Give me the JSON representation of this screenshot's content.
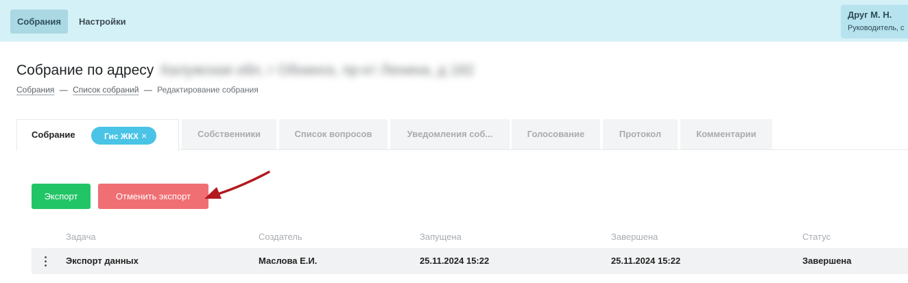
{
  "nav": {
    "items": [
      {
        "label": "Собрания"
      },
      {
        "label": "Настройки"
      }
    ]
  },
  "user": {
    "name": "Друг М. Н.",
    "role": "Руководитель, с"
  },
  "page": {
    "title": "Собрание по адресу",
    "address": "Калужская обл, г Обнинск, пр-кт Ленина, д 182"
  },
  "breadcrumb": {
    "items": [
      "Собрания",
      "Список собраний",
      "Редактирование собрания"
    ],
    "separator": "—"
  },
  "tabs": [
    {
      "label": "Собрание"
    },
    {
      "label": "Собственники"
    },
    {
      "label": "Список вопросов"
    },
    {
      "label": "Уведомления соб..."
    },
    {
      "label": "Голосование"
    },
    {
      "label": "Протокол"
    },
    {
      "label": "Комментарии"
    }
  ],
  "gis_chip": {
    "label": "Гис ЖКХ",
    "close": "×"
  },
  "actions": {
    "export_label": "Экспорт",
    "cancel_export_label": "Отменить экспорт"
  },
  "table": {
    "columns": [
      "Задача",
      "Создатель",
      "Запущена",
      "Завершена",
      "Статус"
    ],
    "rows": [
      [
        "Экспорт данных",
        "Маслова Е.И.",
        "25.11.2024 15:22",
        "25.11.2024 15:22",
        "Завершена"
      ]
    ]
  },
  "colors": {
    "topbar": "#d4f1f7",
    "accent_chip": "#49c3e6",
    "export_button": "#22c565",
    "cancel_button": "#ef6f73",
    "annotation_arrow": "#b3191d"
  },
  "icons": {
    "row_menu": "kebab-menu-icon",
    "chip_close": "close-icon",
    "annotation": "red-arrow-annotation"
  }
}
